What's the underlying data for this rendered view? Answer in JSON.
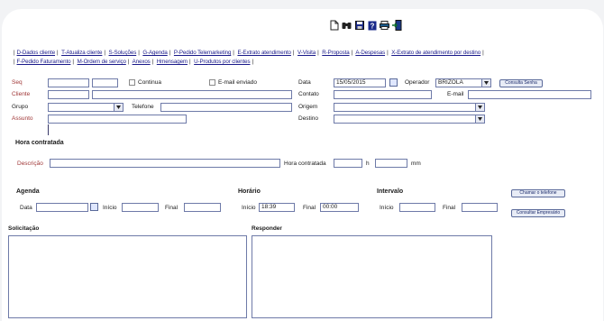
{
  "toolbar": {
    "icons": [
      "new-document-icon",
      "binoculars-icon",
      "save-icon",
      "help-icon",
      "print-icon",
      "exit-icon"
    ]
  },
  "nav": {
    "row1": [
      "D-Dados cliente",
      "T-Atualiza cliente",
      "S-Soluções",
      "G-Agenda",
      "P-Pedido Telemarketing",
      "E-Extrato atendimento",
      "V-Visita",
      "R-Proposta",
      "A-Despesas",
      "X-Extrato de atendimento por destino"
    ],
    "row2": [
      "F-Pedido Faturamento",
      "M-Ordem de serviço",
      "Anexos",
      "Hmensagem",
      "U-Produtos por clientes"
    ]
  },
  "form": {
    "seq_label": "Seq",
    "continua_label": "Continua",
    "email_enviado_label": "E-mail enviado",
    "data_label": "Data",
    "data_value": "15/05/2015",
    "operador_label": "Operador",
    "operador_value": "BRIZOLA",
    "consulta_senha": "Consulta Senha",
    "cliente_label": "Cliente",
    "contato_label": "Contato",
    "email_label": "E-mail",
    "grupo_label": "Grupo",
    "telefone_label": "Telefone",
    "origem_label": "Origem",
    "assunto_label": "Assunto",
    "destino_label": "Destino",
    "hora_contratada_title": "Hora contratada",
    "descricao_label": "Descrição",
    "hora_contratada_label": "Hora contratada",
    "h_label": "h",
    "mm_label": "mm"
  },
  "agenda": {
    "title": "Agenda",
    "data_label": "Data",
    "inicio_label": "Início",
    "final_label": "Final"
  },
  "horario": {
    "title": "Horário",
    "inicio_label": "Início",
    "inicio_value": "18:39",
    "final_label": "Final",
    "final_value": "00:00"
  },
  "intervalo": {
    "title": "Intervalo",
    "inicio_label": "Início",
    "final_label": "Final"
  },
  "buttons": {
    "chamar_telefone": "Chamar o telefone",
    "consultar_empresario": "Consultar Empresário"
  },
  "solicitacao_label": "Solicitação",
  "responder_label": "Responder"
}
